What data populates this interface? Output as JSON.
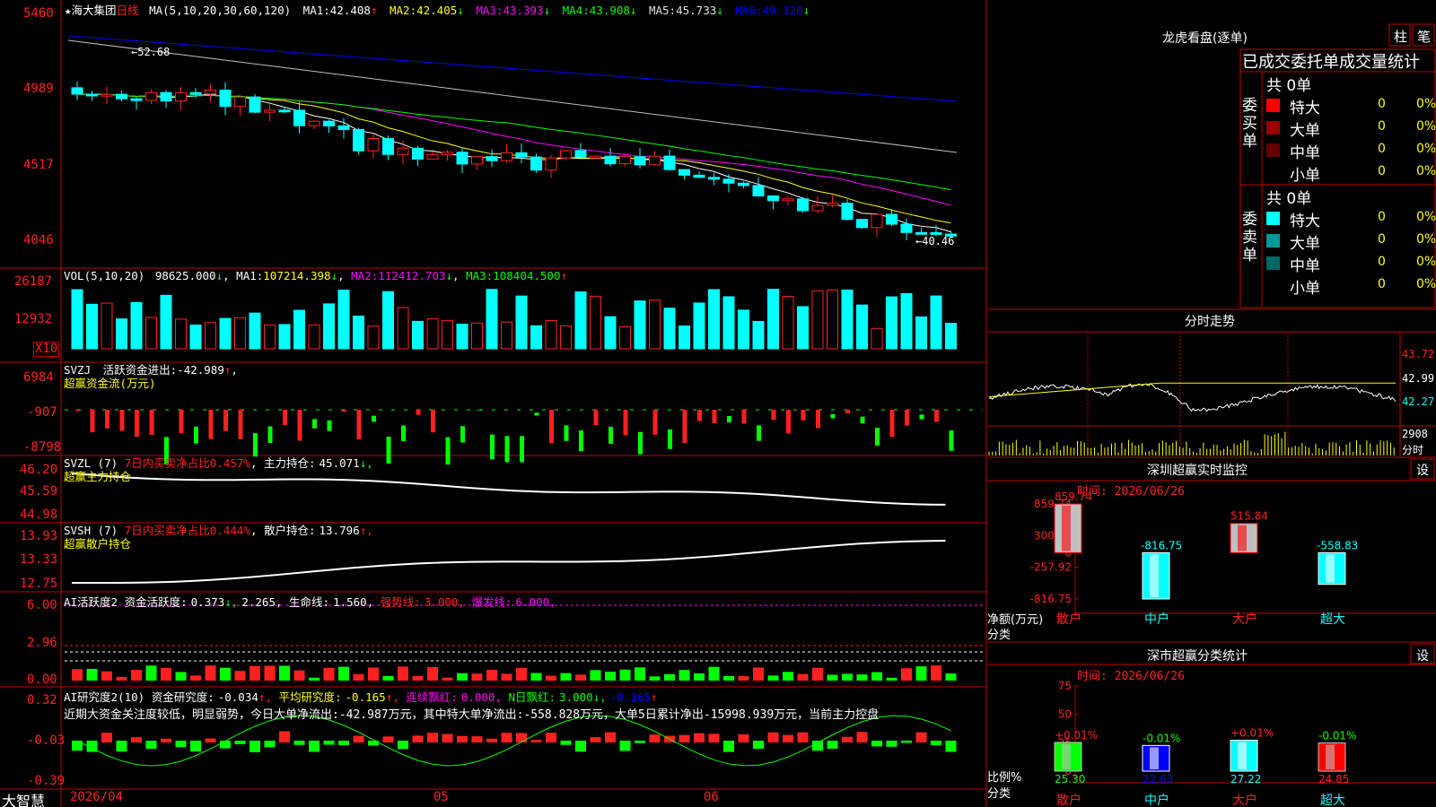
{
  "colors": {
    "up": "#ff2020",
    "down": "#00ffff",
    "ma1": "#ffffff",
    "ma2": "#ffff00",
    "ma3": "#ff00ff",
    "ma4": "#00ff00",
    "ma5": "#c0c0c0",
    "ma6": "#0000ff",
    "grid": "#c00000"
  },
  "main": {
    "star": "★",
    "stock_name": "海大集团",
    "period": "日线",
    "ma_params": "MA(5,10,20,30,60,120)",
    "ma": [
      {
        "label": "MA1:",
        "value": "42.408",
        "arrow": "↑"
      },
      {
        "label": "MA2:",
        "value": "42.405",
        "arrow": "↓"
      },
      {
        "label": "MA3:",
        "value": "43.393",
        "arrow": "↓"
      },
      {
        "label": "MA4:",
        "value": "43.908",
        "arrow": "↓"
      },
      {
        "label": "MA5:",
        "value": "45.733",
        "arrow": "↓"
      },
      {
        "label": "MA6:",
        "value": "49.120",
        "arrow": "↓"
      }
    ],
    "high_label": "←52.68",
    "low_label": "←40.46",
    "yticks": [
      "5460",
      "4989",
      "4517",
      "4046"
    ]
  },
  "vol": {
    "params": "VOL(5,10,20)",
    "value": "98625.000",
    "arrow": "↓",
    "ma": [
      {
        "label": "MA1:",
        "value": "107214.398",
        "arrow": "↓"
      },
      {
        "label": "MA2:",
        "value": "112412.703",
        "arrow": "↓"
      },
      {
        "label": "MA3:",
        "value": "108404.500",
        "arrow": "↑"
      }
    ],
    "yticks": [
      "26187",
      "12932"
    ],
    "unit": "X10"
  },
  "svzj": {
    "code": "SVZJ",
    "title": "活跃资金进出:",
    "value": "-42.989",
    "arrow": "↑",
    "sub": "超赢资金流(万元)",
    "yticks": [
      "6984",
      "-907",
      "-8798"
    ]
  },
  "svzl": {
    "code": "SVZL (7)",
    "text1": "7日内买卖净占比0.457%",
    "label2": "主力持仓:",
    "value2": "45.071",
    "arrow": "↓,",
    "sub": "超赢主力持仓",
    "yticks": [
      "46.20",
      "45.59",
      "44.98"
    ]
  },
  "svsh": {
    "code": "SVSH (7)",
    "text1": "7日内买卖净占比0.444%",
    "label2": "散户持仓:",
    "value2": "13.796",
    "arrow": "↑,",
    "sub": "超赢散户持仓",
    "yticks": [
      "13.93",
      "13.33",
      "12.75"
    ]
  },
  "ai1": {
    "title": "AI活跃度2 资金活跃度:",
    "v1": "0.373",
    "a1": "↓,",
    "v2": "2.265,",
    "label3": "生命线:",
    "v3": "1.560,",
    "label4": "强势线:",
    "v4": "3.000,",
    "label5": "爆发线:",
    "v5": "6.000,",
    "yticks": [
      "6.00",
      "2.96",
      "0.00"
    ]
  },
  "ai2": {
    "title": "AI研究度2(10) 资金研究度:",
    "v1": "-0.034",
    "a1": "↑,",
    "label2": "平均研究度:",
    "v2": "-0.165",
    "a2": "↑,",
    "label3": "连续飘红:",
    "v3": "0.000,",
    "label4": "N日飘红:",
    "v4": "3.000",
    "a4": "↓,",
    "v5": "-0.165",
    "a5": "↑",
    "comment": "近期大资金关注度较低，明显弱势，今日大单净流出:-42.987万元，其中特大单净流出:-558.828万元，大单5日累计净出-15998.939万元，当前主力控盘",
    "yticks": [
      "0.32",
      "-0.03",
      "-0.39"
    ]
  },
  "bottom": {
    "app": "大智慧",
    "dates": [
      "2026/04",
      "05",
      "06"
    ]
  },
  "dragon": {
    "title": "龙虎看盘(逐单)",
    "btn1": "柱",
    "btn2": "笔",
    "header": "已成交委托单成交量统计",
    "buy": {
      "total": "共 0单",
      "side": "委买单",
      "rows": [
        {
          "label": "特大",
          "count": "0",
          "pct": "0%"
        },
        {
          "label": "大单",
          "count": "0",
          "pct": "0%"
        },
        {
          "label": "中单",
          "count": "0",
          "pct": "0%"
        },
        {
          "label": "小单",
          "count": "0",
          "pct": "0%"
        }
      ]
    },
    "sell": {
      "total": "共 0单",
      "side": "委卖单",
      "rows": [
        {
          "label": "特大",
          "count": "0",
          "pct": "0%"
        },
        {
          "label": "大单",
          "count": "0",
          "pct": "0%"
        },
        {
          "label": "中单",
          "count": "0",
          "pct": "0%"
        },
        {
          "label": "小单",
          "count": "0",
          "pct": "0%"
        }
      ]
    }
  },
  "intraday": {
    "title": "分时走势",
    "prices": [
      "43.72",
      "42.99",
      "42.27"
    ],
    "vol": "2908",
    "vol_unit": "分时"
  },
  "monitor": {
    "title": "深圳超赢实时监控",
    "btn": "设",
    "time": "时间: 2026/06/26",
    "yticks": [
      "859.74",
      "300.91",
      "0",
      "-257.92",
      "-816.75"
    ],
    "ylabel1": "净额(万元)",
    "ylabel2": "分类"
  },
  "classify": {
    "title": "深市超赢分类统计",
    "btn": "设",
    "time": "时间: 2026/06/26",
    "yticks": [
      "75",
      "50",
      "25",
      "0"
    ],
    "ylabel1": "比例%",
    "ylabel2": "分类"
  },
  "chart_data": [
    {
      "type": "bar",
      "title": "深圳超赢实时监控",
      "ylabel": "净额(万元)",
      "xlabel": "分类",
      "categories": [
        "散户",
        "中户",
        "大户",
        "超大"
      ],
      "values": [
        859.74,
        -816.75,
        515.84,
        -558.83
      ],
      "ylim": [
        -816.75,
        859.74
      ]
    },
    {
      "type": "bar",
      "title": "深市超赢分类统计",
      "ylabel": "比例%",
      "xlabel": "分类",
      "categories": [
        "散户",
        "中户",
        "大户",
        "超大"
      ],
      "values": [
        25.3,
        22.63,
        27.22,
        24.85
      ],
      "changes": [
        "+0.01%",
        "-0.01%",
        "+0.01%",
        "-0.01%"
      ],
      "ylim": [
        0,
        75
      ]
    },
    {
      "type": "line",
      "title": "分时走势",
      "ylim": [
        42.27,
        43.72
      ]
    }
  ]
}
